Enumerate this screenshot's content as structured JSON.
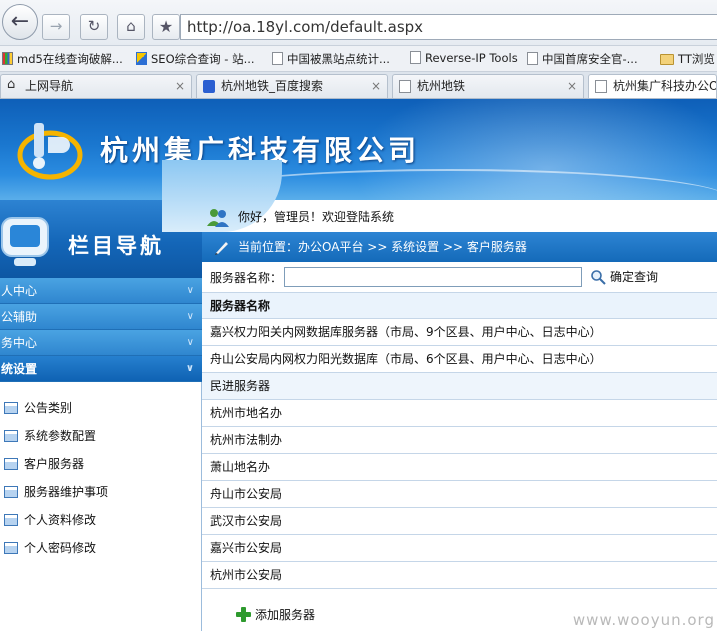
{
  "browser": {
    "address": "http://oa.18yl.com/default.aspx",
    "bookmarks": [
      {
        "label": "md5在线查询破解...",
        "icon": "multicolor-page-icon"
      },
      {
        "label": "SEO综合查询 - 站...",
        "icon": "seo-icon"
      },
      {
        "label": "中国被黑站点统计...",
        "icon": "page-icon"
      },
      {
        "label": "Reverse-IP Tools",
        "icon": "page-icon"
      },
      {
        "label": "中国首席安全官-...",
        "icon": "page-icon"
      },
      {
        "label": "TT浏览",
        "icon": "folder-icon"
      }
    ],
    "tabs": [
      {
        "label": "上网导航",
        "icon": "house-icon"
      },
      {
        "label": "杭州地铁_百度搜索",
        "icon": "paw-icon"
      },
      {
        "label": "杭州地铁",
        "icon": "page-icon"
      },
      {
        "label": "杭州集广科技办公O...",
        "icon": "page-icon"
      }
    ],
    "tab_close": "×"
  },
  "header": {
    "company": "杭州集广科技有限公司"
  },
  "sidebar": {
    "title": "栏目导航",
    "groups": [
      {
        "label": "人中心"
      },
      {
        "label": "公辅助"
      },
      {
        "label": "务中心"
      },
      {
        "label": "统设置"
      }
    ],
    "sub_items": [
      {
        "label": "公告类别"
      },
      {
        "label": "系统参数配置"
      },
      {
        "label": "客户服务器"
      },
      {
        "label": "服务器维护事项"
      },
      {
        "label": "个人资料修改"
      },
      {
        "label": "个人密码修改"
      }
    ]
  },
  "main": {
    "welcome": "你好，管理员！欢迎登陆系统",
    "breadcrumb": "当前位置：办公OA平台 >> 系统设置 >> 客户服务器",
    "search_label": "服务器名称：",
    "search_value": "",
    "query_label": "确定查询",
    "table_header": "服务器名称",
    "rows": [
      "嘉兴权力阳关内网数据库服务器（市局、9个区县、用户中心、日志中心）",
      "舟山公安局内网权力阳光数据库（市局、6个区县、用户中心、日志中心）",
      "民进服务器",
      "杭州市地名办",
      "杭州市法制办",
      "萧山地名办",
      "舟山市公安局",
      "武汉市公安局",
      "嘉兴市公安局",
      "杭州市公安局"
    ],
    "add_label": "添加服务器"
  },
  "watermark": "www.wooyun.org",
  "colors": {
    "banner": "#1a77cf",
    "menu_blue": "#2f86cf",
    "row_border": "#c5d6e8"
  }
}
